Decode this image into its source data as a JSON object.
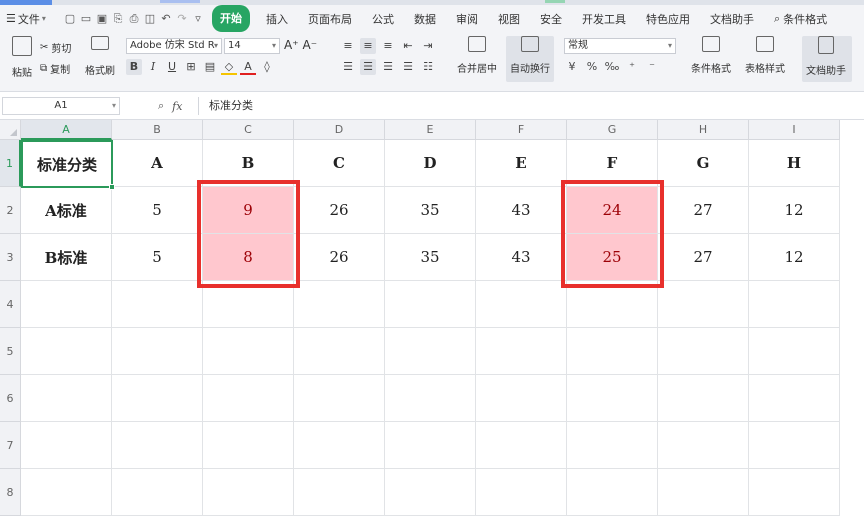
{
  "menu": {
    "file_label": "文件",
    "tabs": [
      "开始",
      "插入",
      "页面布局",
      "公式",
      "数据",
      "审阅",
      "视图",
      "安全",
      "开发工具",
      "特色应用",
      "文档助手"
    ],
    "search_label": "条件格式"
  },
  "ribbon": {
    "paste": "粘贴",
    "cut": "剪切",
    "copy": "复制",
    "format_painter": "格式刷",
    "font_name": "Adobe 仿宋 Std R",
    "font_size": "14",
    "merge_center": "合并居中",
    "wrap_text": "自动换行",
    "number_format": "常规",
    "conditional_format": "条件格式",
    "table_style": "表格样式",
    "doc_helper": "文档助手"
  },
  "formula_bar": {
    "cell_ref": "A1",
    "content": "标准分类"
  },
  "sheet": {
    "columns": [
      "A",
      "B",
      "C",
      "D",
      "E",
      "F",
      "G",
      "H",
      "I"
    ],
    "rows": [
      "1",
      "2",
      "3",
      "4",
      "5",
      "6",
      "7",
      "8"
    ],
    "cells": [
      [
        "标准分类",
        "A",
        "B",
        "C",
        "D",
        "E",
        "F",
        "G",
        "H"
      ],
      [
        "A标准",
        "5",
        "9",
        "26",
        "35",
        "43",
        "24",
        "27",
        "12"
      ],
      [
        "B标准",
        "5",
        "8",
        "26",
        "35",
        "43",
        "25",
        "27",
        "12"
      ]
    ],
    "highlight_color": "#ffc7ce",
    "highlight_text_color": "#9c0006",
    "selection_color": "#2b9a5a",
    "annotation_color": "#e8302c"
  }
}
